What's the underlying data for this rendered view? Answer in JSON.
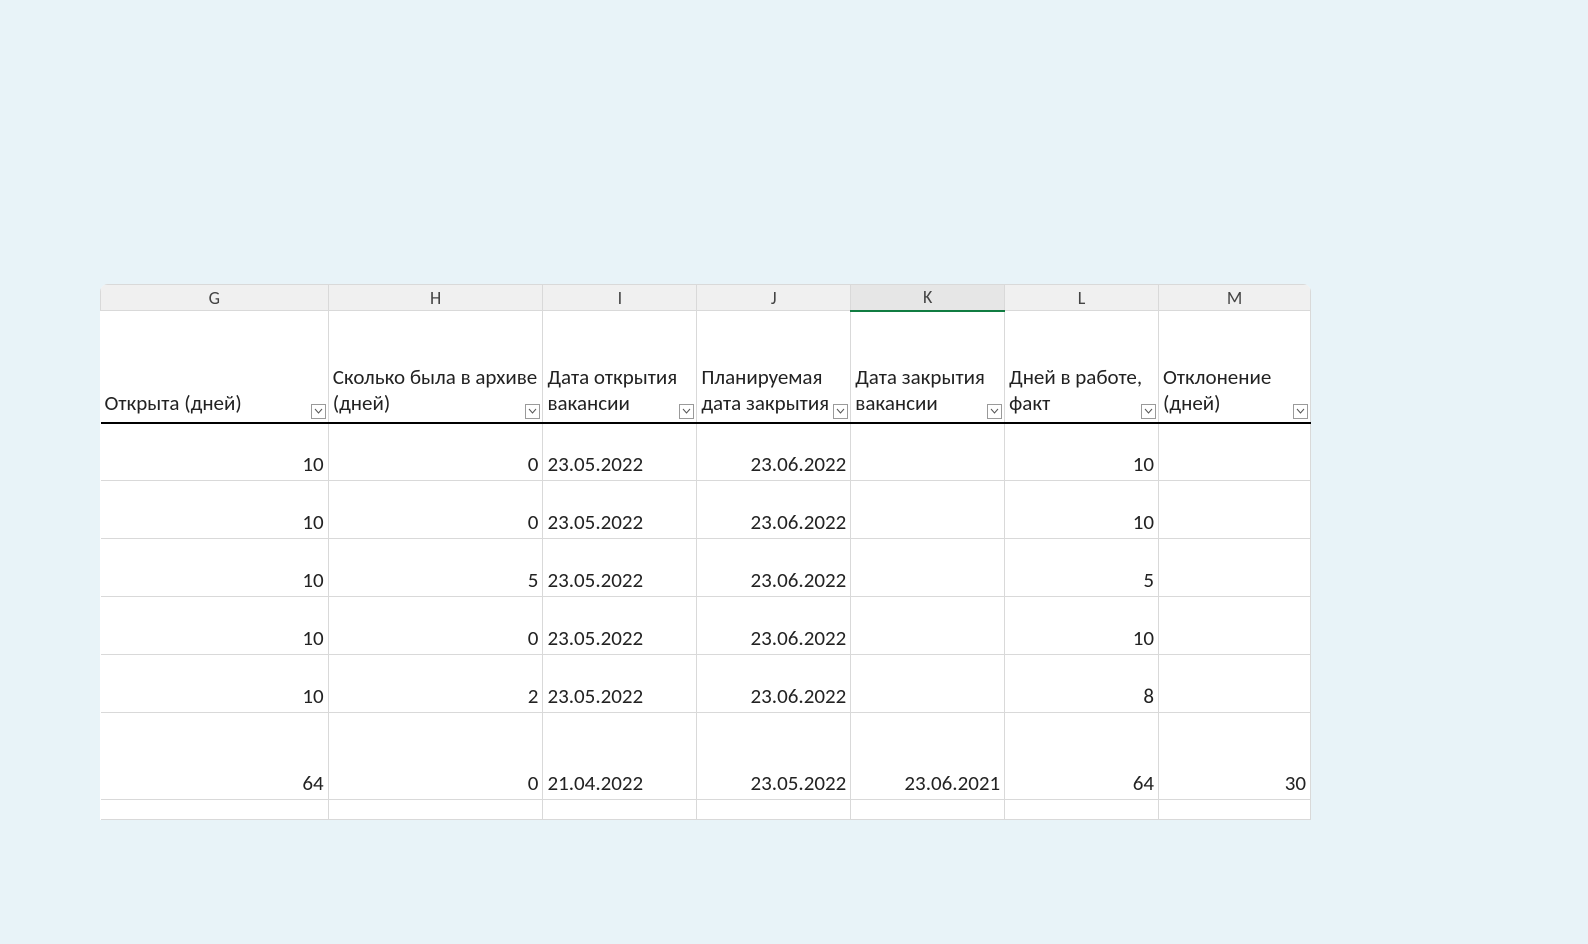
{
  "columns": [
    {
      "letter": "G",
      "header": "Открыта (дней)",
      "selected": false
    },
    {
      "letter": "H",
      "header": "Сколько была в архиве (дней)",
      "selected": false
    },
    {
      "letter": "I",
      "header": "Дата открытия вакансии",
      "selected": false
    },
    {
      "letter": "J",
      "header": "Планируемая дата закрытия",
      "selected": false
    },
    {
      "letter": "K",
      "header": "Дата закрытия вакансии",
      "selected": true
    },
    {
      "letter": "L",
      "header": "Дней в работе, факт",
      "selected": false
    },
    {
      "letter": "M",
      "header": "Отклонение (дней)",
      "selected": false
    }
  ],
  "rows": [
    {
      "G": "10",
      "H": "0",
      "I": "23.05.2022",
      "J": "23.06.2022",
      "K": "",
      "L": "10",
      "M": ""
    },
    {
      "G": "10",
      "H": "0",
      "I": "23.05.2022",
      "J": "23.06.2022",
      "K": "",
      "L": "10",
      "M": ""
    },
    {
      "G": "10",
      "H": "5",
      "I": "23.05.2022",
      "J": "23.06.2022",
      "K": "",
      "L": "5",
      "M": ""
    },
    {
      "G": "10",
      "H": "0",
      "I": "23.05.2022",
      "J": "23.06.2022",
      "K": "",
      "L": "10",
      "M": ""
    },
    {
      "G": "10",
      "H": "2",
      "I": "23.05.2022",
      "J": "23.06.2022",
      "K": "",
      "L": "8",
      "M": ""
    },
    {
      "G": "64",
      "H": "0",
      "I": "21.04.2022",
      "J": "23.05.2022",
      "K": "23.06.2021",
      "L": "64",
      "M": "30"
    }
  ]
}
